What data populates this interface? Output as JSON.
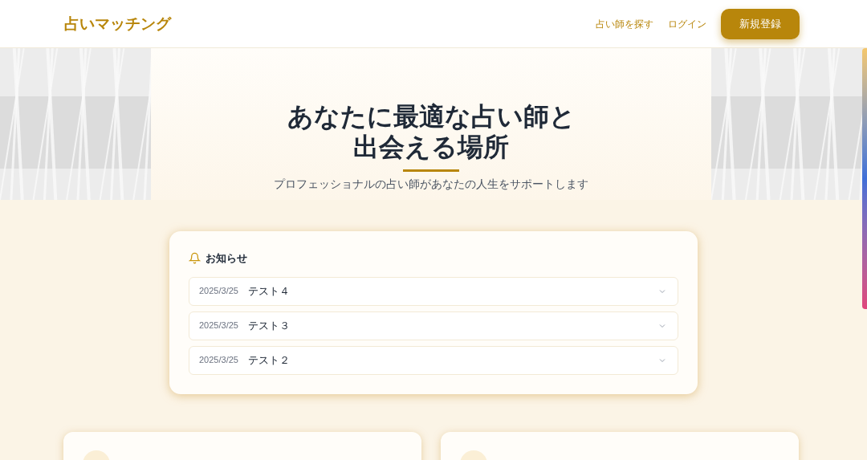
{
  "header": {
    "logo": "占いマッチング",
    "nav": [
      {
        "label": "占い師を探す",
        "kind": "link"
      },
      {
        "label": "ログイン",
        "kind": "link"
      },
      {
        "label": "新規登録",
        "kind": "button"
      }
    ]
  },
  "hero": {
    "title_lines": [
      "あなたに最適な占い師と",
      "出会える場所"
    ],
    "subtitle": "プロフェッショナルの占い師があなたの人生をサポートします"
  },
  "notices": {
    "title": "お知らせ",
    "items": [
      {
        "date": "2025/3/25",
        "title": "テスト４",
        "expanded": false
      },
      {
        "date": "2025/3/25",
        "title": "テスト３",
        "expanded": false
      },
      {
        "date": "2025/3/25",
        "title": "テスト２",
        "expanded": false
      }
    ]
  }
}
